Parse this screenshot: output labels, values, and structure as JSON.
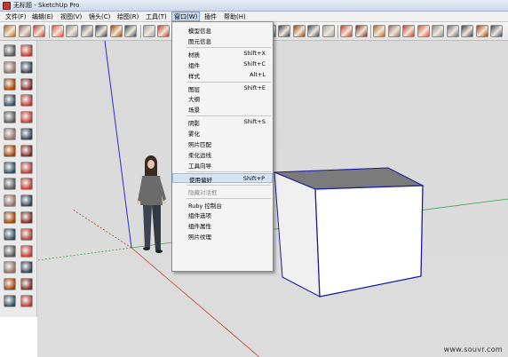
{
  "window": {
    "title": "无标题 - SketchUp Pro",
    "app_icon": "sketchup-icon"
  },
  "menubar": {
    "items": [
      {
        "label": "文件(F)"
      },
      {
        "label": "编辑(E)"
      },
      {
        "label": "视图(V)"
      },
      {
        "label": "镜头(C)"
      },
      {
        "label": "绘图(R)"
      },
      {
        "label": "工具(T)"
      },
      {
        "label": "窗口(W)"
      },
      {
        "label": "插件"
      },
      {
        "label": "帮助(H)"
      }
    ],
    "active_index": 6
  },
  "window_menu": {
    "items": [
      {
        "label": "模型信息",
        "shortcut": "",
        "state": "normal"
      },
      {
        "label": "图元信息",
        "shortcut": "",
        "state": "normal"
      },
      {
        "type": "divider"
      },
      {
        "label": "材质",
        "shortcut": "Shift+X",
        "state": "normal"
      },
      {
        "label": "组件",
        "shortcut": "Shift+C",
        "state": "normal"
      },
      {
        "label": "样式",
        "shortcut": "Alt+L",
        "state": "normal"
      },
      {
        "type": "divider"
      },
      {
        "label": "图层",
        "shortcut": "Shift+E",
        "state": "normal"
      },
      {
        "label": "大纲",
        "shortcut": "",
        "state": "normal"
      },
      {
        "label": "场景",
        "shortcut": "",
        "state": "normal"
      },
      {
        "type": "divider"
      },
      {
        "label": "阴影",
        "shortcut": "Shift+S",
        "state": "normal"
      },
      {
        "label": "雾化",
        "shortcut": "",
        "state": "normal"
      },
      {
        "label": "照片匹配",
        "shortcut": "",
        "state": "normal"
      },
      {
        "label": "柔化边线",
        "shortcut": "",
        "state": "normal"
      },
      {
        "label": "工具向导",
        "shortcut": "",
        "state": "normal"
      },
      {
        "type": "divider"
      },
      {
        "label": "使用偏好",
        "shortcut": "Shift+P",
        "state": "highlighted"
      },
      {
        "type": "divider"
      },
      {
        "label": "隐藏对话框",
        "shortcut": "",
        "state": "disabled"
      },
      {
        "type": "divider"
      },
      {
        "label": "Ruby 控制台",
        "shortcut": "",
        "state": "normal"
      },
      {
        "label": "组件选项",
        "shortcut": "",
        "state": "normal"
      },
      {
        "label": "组件属性",
        "shortcut": "",
        "state": "normal"
      },
      {
        "label": "照片纹理",
        "shortcut": "",
        "state": "normal"
      }
    ]
  },
  "toolbar": {
    "icons": [
      "new-icon",
      "open-icon",
      "cut-icon",
      "copy-icon",
      "paste-icon",
      "erase-icon",
      "undo-icon",
      "redo-icon",
      "print-icon",
      "model-info-icon",
      "iso-view-icon",
      "top-view-icon",
      "front-view-icon",
      "right-view-icon",
      "back-view-icon",
      "left-view-icon",
      "xray-icon",
      "wireframe-icon",
      "hidden-line-icon",
      "shaded-icon",
      "textured-icon",
      "monochrome-icon",
      "section-plane-icon",
      "section-cut-icon",
      "orbit-icon",
      "pan-icon",
      "zoom-icon",
      "zoom-window-icon",
      "zoom-extents-icon",
      "previous-icon",
      "next-icon",
      "walk-icon",
      "look-around-icon"
    ]
  },
  "left_toolbar": {
    "icons": [
      "select-icon",
      "eraser-icon",
      "paint-bucket-icon",
      "make-component-icon",
      "rectangle-icon",
      "line-icon",
      "circle-icon",
      "arc-icon",
      "polygon-icon",
      "freehand-icon",
      "move-icon",
      "push-pull-icon",
      "rotate-icon",
      "follow-me-icon",
      "scale-icon",
      "offset-icon",
      "tape-measure-icon",
      "dimension-icon",
      "protractor-icon",
      "text-icon",
      "axes-icon",
      "3d-text-icon",
      "orbit-icon",
      "pan-icon",
      "zoom-icon",
      "zoom-window-icon",
      "zoom-extents-icon",
      "previous-view-icon",
      "position-camera-icon",
      "walk-icon",
      "look-around-icon",
      "section-plane-icon"
    ]
  },
  "canvas": {
    "model": "box-with-person-figure",
    "colors": {
      "background": "#dadada",
      "box_face": "#ffffff",
      "box_top": "#7a7a7a",
      "box_edge": "#1a1aa8",
      "axis_blue": "#2b2bd6",
      "axis_red": "#c0392b",
      "axis_green": "#4caf50"
    }
  },
  "watermark": {
    "text": "www.souvr.com"
  },
  "colors": {
    "menu_highlight": "#d4e3f6",
    "active_menu": "#c7d8ef"
  }
}
